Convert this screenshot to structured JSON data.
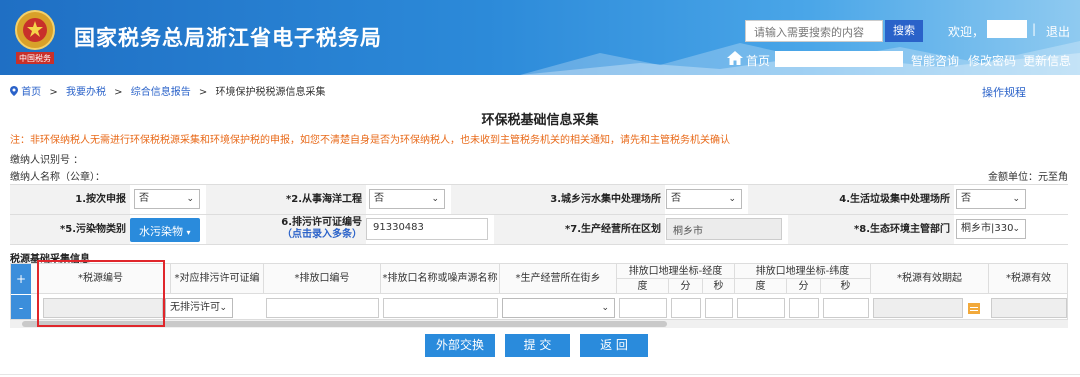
{
  "header": {
    "site_title": "国家税务总局浙江省电子税务局",
    "emblem_text": "中国税务",
    "search_placeholder": "请输入需要搜索的内容",
    "search_button": "搜索",
    "welcome": "欢迎，",
    "pipe": "|",
    "logout": "退出",
    "home": "首页",
    "nav": [
      "智能咨询",
      "修改密码",
      "更新信息"
    ]
  },
  "breadcrumb": {
    "items": [
      "首页",
      "我要办税",
      "综合信息报告",
      "环境保护税税源信息采集"
    ],
    "sep": ">"
  },
  "help_link": "操作规程",
  "page_title": "环保税基础信息采集",
  "notice": "注：非环保纳税人无需进行环保税税源采集和环境保护税的申报，如您不清楚自身是否为环保纳税人，也未收到主管税务机关的相关通知，请先和主管税务机关确认",
  "taxpayer": {
    "id_label": "缴纳人识别号 ：",
    "name_label": "缴纳人名称（公章）：",
    "unit": "金额单位：元至角"
  },
  "form": {
    "row1": [
      {
        "label": "1.按次申报",
        "value": "否"
      },
      {
        "label": "*2.从事海洋工程",
        "value": "否"
      },
      {
        "label": "3.城乡污水集中处理场所",
        "value": "否"
      },
      {
        "label": "4.生活垃圾集中处理场所",
        "value": "否"
      }
    ],
    "row2": {
      "pollutant_label": "*5.污染物类别",
      "pollutant_button": "水污染物",
      "permit_label": "6.排污许可证编号",
      "permit_sub": "（点击录入多条）",
      "permit_value": "91330483",
      "district_label": "*7.生产经营所在区划",
      "district_value": "桐乡市",
      "authority_label": "*8.生态环境主管部门",
      "authority_value": "桐乡市|330"
    }
  },
  "section_title": "税源基础采集信息",
  "table": {
    "headers": [
      "*税源编号",
      "*对应排污许可证编号",
      "*排放口编号",
      "*排放口名称或噪声源名称",
      "*生产经营所在街乡",
      "排放口地理坐标-经度",
      "排放口地理坐标-纬度",
      "*税源有效期起",
      "*税源有效"
    ],
    "sub_headers": [
      "度",
      "分",
      "秒",
      "度",
      "分",
      "秒"
    ],
    "row_permit_value": "无排污许可",
    "add_symbol": "+",
    "remove_symbol": "-"
  },
  "actions": [
    "外部交换",
    "提 交",
    "返 回"
  ],
  "colors": {
    "primary": "#2a8bdc",
    "notice": "#e86a1a",
    "highlight": "#e0262b"
  }
}
